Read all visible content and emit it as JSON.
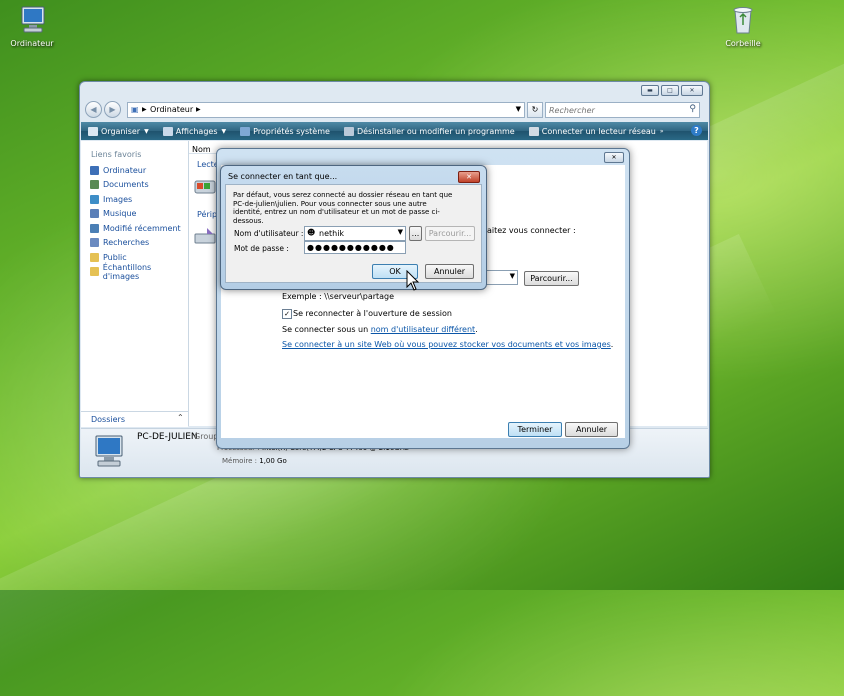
{
  "desktop": {
    "icons": [
      {
        "label": "Ordinateur",
        "icon": "computer-icon"
      },
      {
        "label": "Corbeille",
        "icon": "recycle-bin-icon"
      }
    ]
  },
  "explorer": {
    "address": {
      "root": "Ordinateur"
    },
    "search": {
      "placeholder": "Rechercher"
    },
    "toolbar": {
      "organiser": "Organiser",
      "affichages": "Affichages",
      "proprietes": "Propriétés système",
      "desinstaller": "Désinstaller ou modifier un programme",
      "connecter": "Connecter un lecteur réseau"
    },
    "sidebar": {
      "header": "Liens favoris",
      "items": [
        {
          "label": "Ordinateur",
          "color": "#3d6fb7"
        },
        {
          "label": "Documents",
          "color": "#5a8a54"
        },
        {
          "label": "Images",
          "color": "#3e8ec7"
        },
        {
          "label": "Musique",
          "color": "#5a7fb8"
        },
        {
          "label": "Modifié récemment",
          "color": "#4b7fb5"
        },
        {
          "label": "Recherches",
          "color": "#6a8ac0"
        },
        {
          "label": "Public",
          "color": "#e5c154"
        },
        {
          "label": "Échantillons d'images",
          "color": "#e5c154"
        }
      ],
      "folders": "Dossiers"
    },
    "content": {
      "column_name": "Nom",
      "item1": "Lecte",
      "item2": "Périp"
    },
    "details": {
      "pc_name": "PC-DE-JULIEN",
      "group": "Group",
      "processor_label": "Processeur :",
      "processor_value": "Intel(R) Core(TM)2 CPU          T7400  @ 2.16GHz",
      "memory_label": "Mémoire :",
      "memory_value": "1,00 Go"
    }
  },
  "wizard": {
    "question_fragment": "aitez vous connecter :",
    "browse": "Parcourir...",
    "example": "Exemple : \\\\serveur\\partage",
    "reconnect": "Se reconnecter à l'ouverture de session",
    "reconnect_checked": true,
    "connect_as_prefix": "Se connecter sous un ",
    "connect_as_link": "nom d'utilisateur différent",
    "connect_as_suffix": ".",
    "website_link": "Se connecter à un site Web où vous pouvez stocker vos documents et vos images",
    "website_suffix": ".",
    "finish": "Terminer",
    "cancel": "Annuler"
  },
  "credentials": {
    "title": "Se connecter en tant que...",
    "description": "Par défaut, vous serez connecté au dossier réseau en tant que PC-de-julien\\julien. Pour vous connecter sous une autre identité, entrez un nom d'utilisateur et un mot de passe ci-dessous.",
    "username_label": "Nom d'utilisateur :",
    "username_value": "nethik",
    "ellipsis": "...",
    "browse": "Parcourir...",
    "password_label": "Mot de passe :",
    "password_value": "●●●●●●●●●●●",
    "ok": "OK",
    "cancel": "Annuler"
  }
}
